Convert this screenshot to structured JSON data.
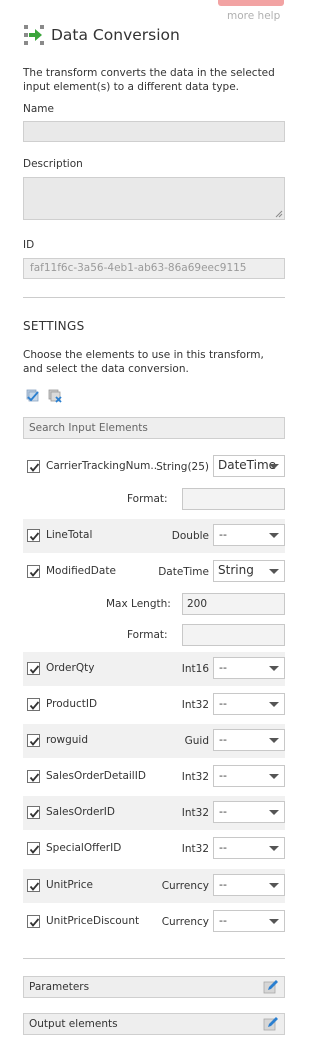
{
  "help": {
    "label": "more help"
  },
  "header": {
    "title": "Data Conversion",
    "icon": "data-conversion-icon"
  },
  "description_text": "The transform converts the data in the selected input element(s) to a different data type.",
  "fields": {
    "name_label": "Name",
    "name_value": "",
    "description_label": "Description",
    "description_value": "",
    "id_label": "ID",
    "id_value": "faf11f6c-3a56-4eb1-ab63-86a69eec9115"
  },
  "settings": {
    "title": "SETTINGS",
    "description": "Choose the elements to use in this transform, and select the data conversion.",
    "search_placeholder": "Search Input Elements"
  },
  "rows": [
    {
      "name": "CarrierTrackingNum...",
      "type": "String(25)",
      "conversion": "DateTime",
      "checked": true
    },
    {
      "name": "LineTotal",
      "type": "Double",
      "conversion": "--",
      "checked": true
    },
    {
      "name": "ModifiedDate",
      "type": "DateTime",
      "conversion": "String",
      "checked": true
    },
    {
      "name": "OrderQty",
      "type": "Int16",
      "conversion": "--",
      "checked": true
    },
    {
      "name": "ProductID",
      "type": "Int32",
      "conversion": "--",
      "checked": true
    },
    {
      "name": "rowguid",
      "type": "Guid",
      "conversion": "--",
      "checked": true
    },
    {
      "name": "SalesOrderDetailID",
      "type": "Int32",
      "conversion": "--",
      "checked": true
    },
    {
      "name": "SalesOrderID",
      "type": "Int32",
      "conversion": "--",
      "checked": true
    },
    {
      "name": "SpecialOfferID",
      "type": "Int32",
      "conversion": "--",
      "checked": true
    },
    {
      "name": "UnitPrice",
      "type": "Currency",
      "conversion": "--",
      "checked": true
    },
    {
      "name": "UnitPriceDiscount",
      "type": "Currency",
      "conversion": "--",
      "checked": true
    }
  ],
  "sub_fields": {
    "format_label": "Format:",
    "max_length_label": "Max Length:",
    "max_length_value": "200",
    "carrier_format_value": "",
    "modified_format_value": ""
  },
  "sections": {
    "parameters": "Parameters",
    "output_elements": "Output elements"
  },
  "colors": {
    "help_tab": "#f2a3a3",
    "icon_green": "#3aa53a",
    "icon_blue": "#2a7fd0"
  }
}
